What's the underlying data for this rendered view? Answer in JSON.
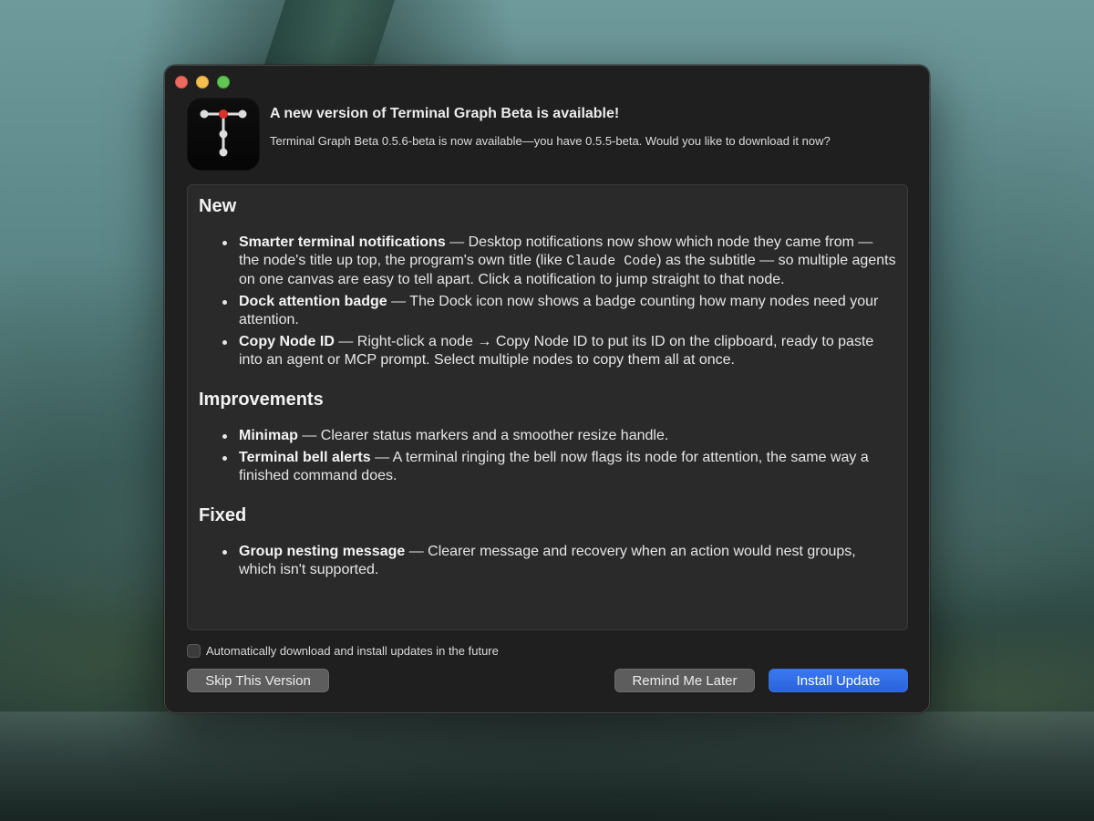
{
  "window": {
    "title": "A new version of Terminal Graph Beta is available!",
    "subtitle": "Terminal Graph Beta 0.5.6-beta is now available—you have 0.5.5-beta. Would you like to download it now?",
    "app_icon": "terminal-graph-icon"
  },
  "sections": [
    {
      "heading": "New",
      "items": [
        {
          "title": "Smarter terminal notifications",
          "text_before": " — Desktop notifications now show which node they came from — the node's title up top, the program's own title (like ",
          "code": "Claude Code",
          "text_after": ") as the subtitle — so multiple agents on one canvas are easy to tell apart. Click a notification to jump straight to that node."
        },
        {
          "title": "Dock attention badge",
          "text": " — The Dock icon now shows a badge counting how many nodes need your attention."
        },
        {
          "title": "Copy Node ID",
          "text": " — Right-click a node → Copy Node ID to put its ID on the clipboard, ready to paste into an agent or MCP prompt. Select multiple nodes to copy them all at once."
        }
      ]
    },
    {
      "heading": "Improvements",
      "items": [
        {
          "title": "Minimap",
          "text": " — Clearer status markers and a smoother resize handle."
        },
        {
          "title": "Terminal bell alerts",
          "text": " — A terminal ringing the bell now flags its node for attention, the same way a finished command does."
        }
      ]
    },
    {
      "heading": "Fixed",
      "items": [
        {
          "title": "Group nesting message",
          "text": " — Clearer message and recovery when an action would nest groups, which isn't supported."
        }
      ]
    }
  ],
  "auto_update": {
    "label": "Automatically download and install updates in the future",
    "checked": false
  },
  "buttons": {
    "skip": "Skip This Version",
    "later": "Remind Me Later",
    "install": "Install Update"
  },
  "colors": {
    "accent": "#2f6be6",
    "close": "#ed6a5e",
    "minimize": "#f5bf4f",
    "zoom": "#61c554",
    "icon_node_red": "#d8312c"
  }
}
